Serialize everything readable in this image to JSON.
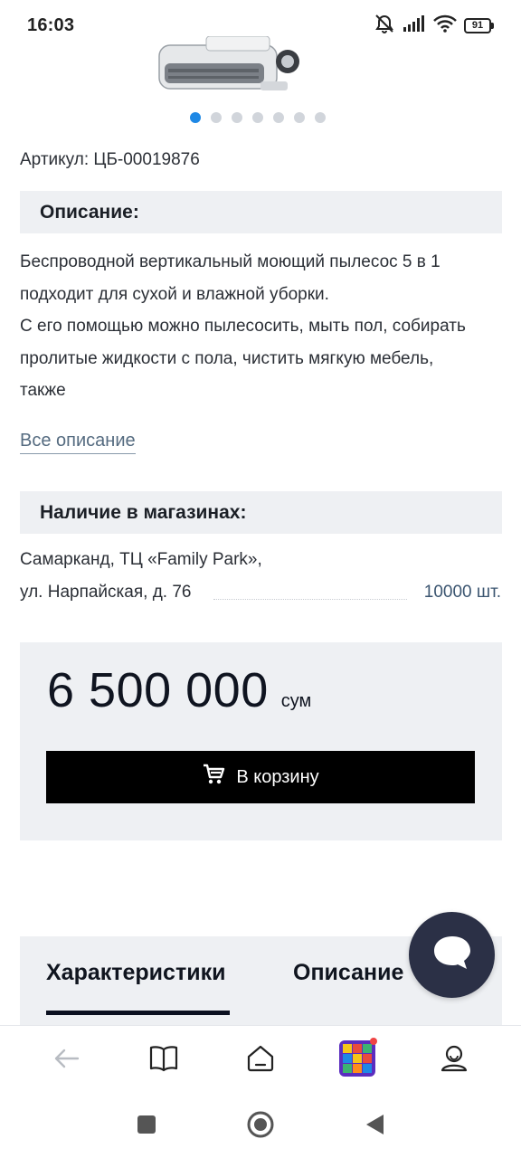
{
  "status_bar": {
    "time": "16:03",
    "battery": "91",
    "icons": [
      "mute-icon",
      "signal-icon",
      "wifi-icon",
      "battery-icon"
    ]
  },
  "product": {
    "carousel": {
      "total": 7,
      "active_index": 0
    },
    "sku": "Артикул: ЦБ-00019876"
  },
  "description": {
    "header": "Описание:",
    "lines": [
      "Беспроводной вертикальный моющий пылесос 5 в 1",
      "подходит для сухой и влажной уборки.",
      "С его помощью можно пылесосить, мыть пол, собирать",
      "пролитые жидкости с пола, чистить мягкую мебель,",
      "также"
    ],
    "link": "Все описание"
  },
  "availability": {
    "header": "Наличие в магазинах:",
    "store_name": "Самарканд, ТЦ «Family Park»,",
    "store_address": "ул. Нарпайская, д. 76",
    "quantity": "10000 шт."
  },
  "price": {
    "value": "6 500 000",
    "currency": "сум",
    "cart_button": "В корзину"
  },
  "tabs": {
    "items": [
      "Характеристики",
      "Описание"
    ],
    "active_index": 0
  },
  "bottom_nav": {
    "items": [
      "back-arrow-icon",
      "catalog-book-icon",
      "home-icon",
      "game-app-icon",
      "profile-icon"
    ],
    "notification_on": "game-app-icon"
  },
  "colors": {
    "accent": "#1e88e5",
    "panel": "#eef0f3",
    "button": "#000000",
    "fab": "#2b3046",
    "link": "#556b80"
  }
}
